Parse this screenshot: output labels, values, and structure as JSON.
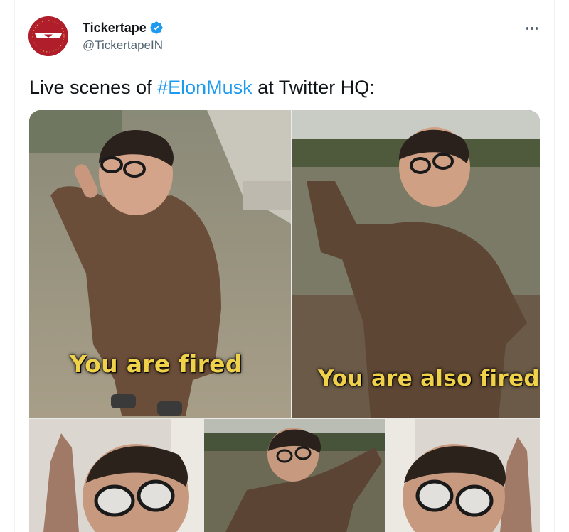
{
  "tweet": {
    "display_name": "Tickertape",
    "handle": "@TickertapeIN",
    "text_before": "Live scenes of ",
    "hashtag": "#ElonMusk",
    "text_after": " at Twitter HQ:",
    "more_icon": "more-horizontal-icon",
    "verified_icon": "verified-badge-icon"
  },
  "media": {
    "panels": [
      {
        "caption": "You are fired"
      },
      {
        "caption": "You are also fired"
      },
      {
        "caption": ""
      },
      {
        "caption": ""
      },
      {
        "caption": ""
      }
    ]
  },
  "colors": {
    "accent": "#1d9bf0",
    "avatar_bg": "#b01e2c",
    "caption": "#f0d24a",
    "secondary_text": "#536471"
  }
}
